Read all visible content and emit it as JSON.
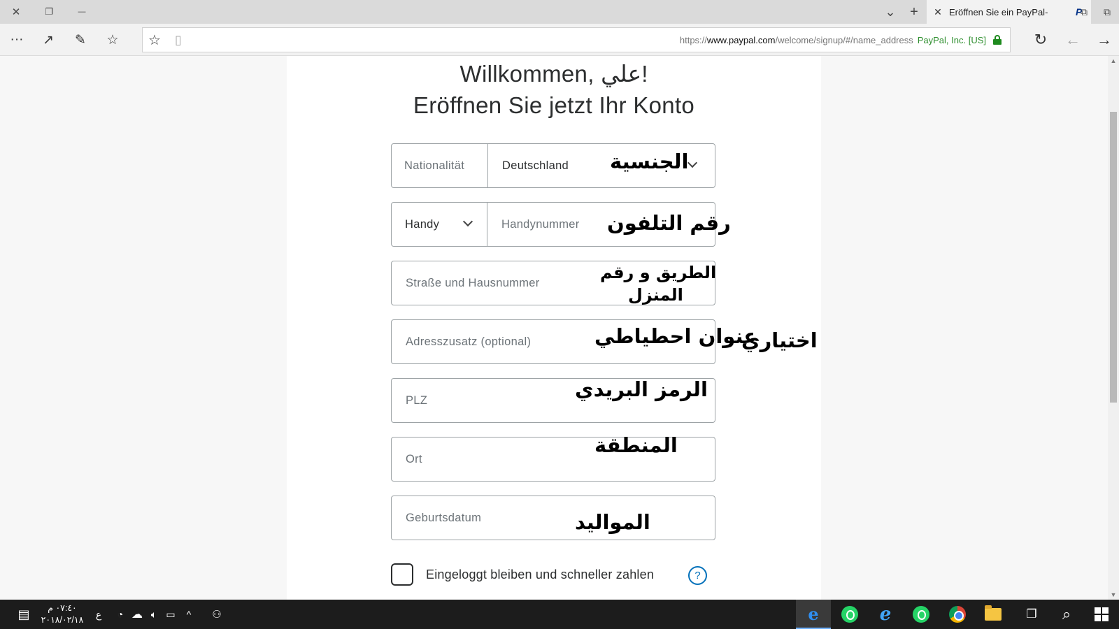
{
  "browser": {
    "tab": {
      "title": "Eröffnen Sie ein PayPal-",
      "favicon": "P",
      "close": "✕"
    },
    "tabbar_icons": {
      "close_window": "✕",
      "restore": "❐",
      "minimize": "—",
      "tab_list": "⌄",
      "new_tab": "+",
      "tab_preview": "⧉",
      "aside_tabs": "⧉"
    },
    "nav_icons": {
      "more": "···",
      "share": "↗",
      "notes": "✎",
      "favorites_hub": "☆",
      "refresh": "↻",
      "back": "←",
      "forward": "→"
    },
    "address": {
      "favorite_star": "☆",
      "reading_view": "▯",
      "url_prefix": "https://",
      "url_domain": "www.paypal.com",
      "url_path": "/welcome/signup/#/name_address",
      "certificate": "PayPal, Inc. [US]"
    }
  },
  "page": {
    "welcome": "Willkommen, علي!",
    "subtitle": "Eröffnen Sie jetzt Ihr Konto",
    "form": {
      "nationality": {
        "label": "Nationalität",
        "value": "Deutschland",
        "annotation": "الجنسية"
      },
      "phone": {
        "type_value": "Handy",
        "placeholder": "Handynummer",
        "annotation": "رقم التلفون"
      },
      "street": {
        "placeholder": "Straße und Hausnummer",
        "annotation_line1": "الطريق و رقم",
        "annotation_line2": "المنزل"
      },
      "address_extra": {
        "placeholder": "Adresszusatz (optional)",
        "annotation": "عنوان احطياطي",
        "side_note": "اختياري"
      },
      "zip": {
        "placeholder": "PLZ",
        "annotation": "الرمز البريدي"
      },
      "city": {
        "placeholder": "Ort",
        "annotation": "المنطقة"
      },
      "birthdate": {
        "placeholder": "Geburtsdatum",
        "annotation": "المواليد"
      },
      "remember": {
        "label": "Eingeloggt bleiben und schneller zahlen",
        "help": "?"
      }
    }
  },
  "taskbar": {
    "clock_time": "٠٧:٤٠ م",
    "clock_date": "٢٠١٨/٠٢/١٨",
    "input_lang": "ع",
    "tray_icons": [
      "wifi-icon",
      "onedrive-icon",
      "volume-icon",
      "battery-icon",
      "chevron-up-icon",
      "people-icon"
    ],
    "apps": [
      "edge-icon",
      "whatsapp-icon",
      "internet-explorer-icon",
      "whatsapp-icon",
      "chrome-icon",
      "file-explorer-icon"
    ],
    "chevron": "^",
    "task_view": "❐",
    "search": "⌕"
  },
  "colors": {
    "link_blue": "#0070ba",
    "secure_green": "#2f8f2f",
    "taskbar": "#1c1c1c"
  }
}
